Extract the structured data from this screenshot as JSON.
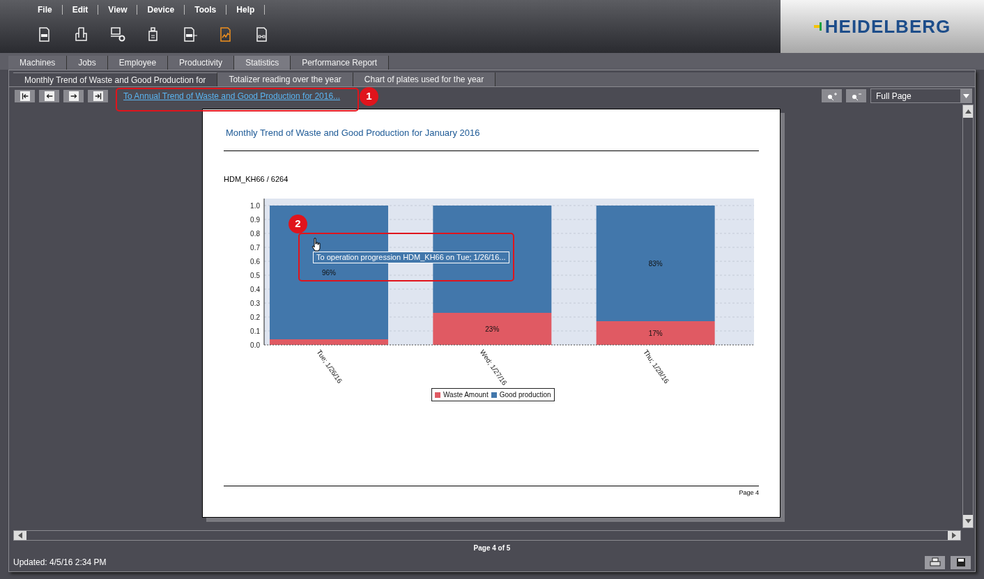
{
  "menu": [
    "File",
    "Edit",
    "View",
    "Device",
    "Tools",
    "Help"
  ],
  "toolbar": [
    {
      "kind": "document-abc",
      "selected": false
    },
    {
      "kind": "printer",
      "selected": false
    },
    {
      "kind": "computer-gear",
      "selected": false
    },
    {
      "kind": "device",
      "selected": false
    },
    {
      "kind": "document-abc-arrow",
      "selected": false
    },
    {
      "kind": "document-chart",
      "selected": true
    },
    {
      "kind": "document-boxes",
      "selected": false
    }
  ],
  "logo": "HEIDELBERG",
  "tabs": [
    {
      "label": "Machines",
      "selected": false
    },
    {
      "label": "Jobs",
      "selected": false
    },
    {
      "label": "Employee",
      "selected": false
    },
    {
      "label": "Productivity",
      "selected": false
    },
    {
      "label": "Statistics",
      "selected": true
    },
    {
      "label": "Performance Report",
      "selected": false
    }
  ],
  "subtabs": [
    {
      "label": "Monthly Trend of Waste and Good Production for",
      "selected": true
    },
    {
      "label": "Totalizer reading over the year",
      "selected": false
    },
    {
      "label": "Chart of plates used for the year",
      "selected": false
    }
  ],
  "report_link": "To Annual Trend of Waste and Good Production for 2016...",
  "zoom_select": "Full Page",
  "page": {
    "title": "Monthly Trend of Waste and Good Production for January 2016",
    "machine": "HDM_KH66 / 6264",
    "footer": "Page 4",
    "chart_data": {
      "type": "bar",
      "stacked": true,
      "orientation": "vertical",
      "categories": [
        "Tue; 1/26/16",
        "Wed; 1/27/16",
        "Thu; 1/28/16"
      ],
      "series": [
        {
          "name": "Waste Amount",
          "color": "#e05a63",
          "values": [
            0.04,
            0.23,
            0.17
          ]
        },
        {
          "name": "Good production",
          "color": "#4277ab",
          "values": [
            0.96,
            0.77,
            0.83
          ]
        }
      ],
      "ylim": [
        0,
        1
      ],
      "yticks": [
        {
          "value": 0,
          "label": "0.0"
        },
        {
          "value": 0.1,
          "label": "0.1"
        },
        {
          "value": 0.2,
          "label": "0.2"
        },
        {
          "value": 0.3,
          "label": "0.3"
        },
        {
          "value": 0.4,
          "label": "0.4"
        },
        {
          "value": 0.5,
          "label": "0.5"
        },
        {
          "value": 0.6,
          "label": "0.6"
        },
        {
          "value": 0.7,
          "label": "0.7"
        },
        {
          "value": 0.8,
          "label": "0.8"
        },
        {
          "value": 0.9,
          "label": "0.9"
        },
        {
          "value": 1,
          "label": "1.0"
        }
      ],
      "value_labels": [
        [
          null,
          "23%",
          "17%"
        ],
        [
          "96%",
          null,
          "83%"
        ]
      ],
      "grid": true,
      "legend": true
    },
    "tooltip": "To operation progression HDM_KH66 on Tue; 1/26/16..."
  },
  "annotations": [
    "1",
    "2"
  ],
  "page_indicator": "Page 4 of 5",
  "status": "Updated: 4/5/16 2:34 PM"
}
